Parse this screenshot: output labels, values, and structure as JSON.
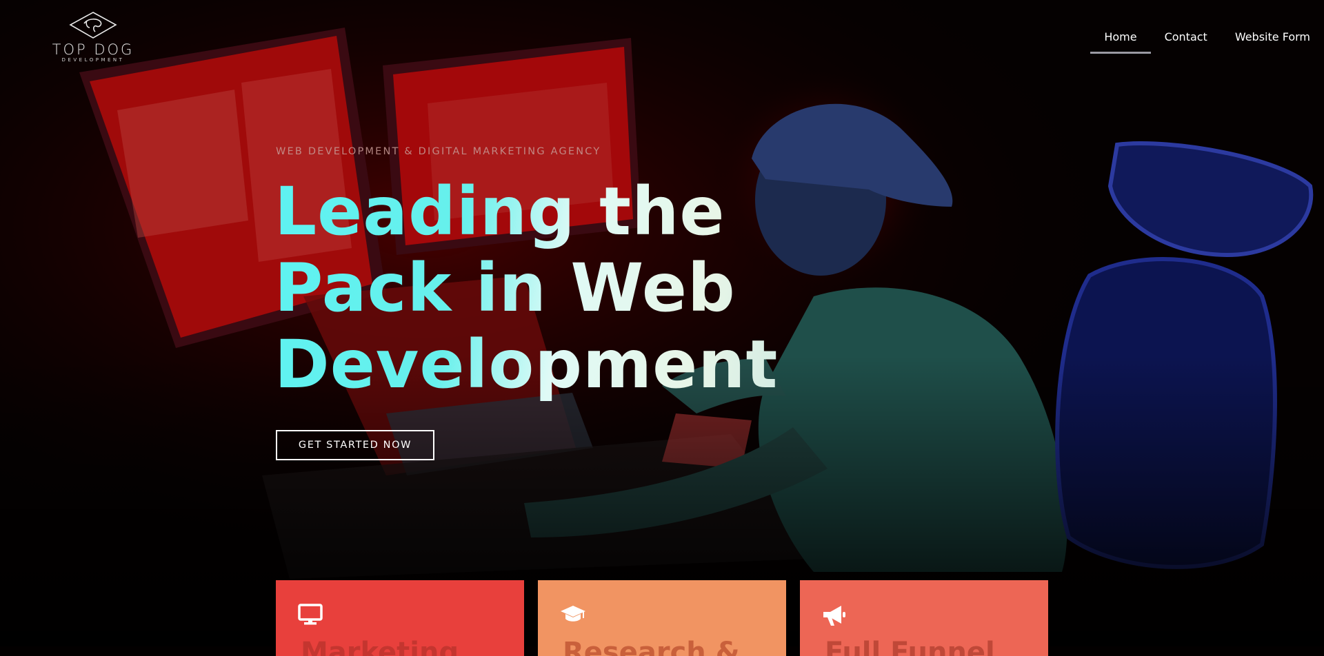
{
  "brand": {
    "name": "TOP DOG",
    "tagline": "DEVELOPMENT"
  },
  "nav": {
    "items": [
      {
        "label": "Home",
        "active": true
      },
      {
        "label": "Contact",
        "active": false
      },
      {
        "label": "Website Form",
        "active": false
      }
    ]
  },
  "hero": {
    "eyebrow": "WEB DEVELOPMENT & DIGITAL MARKETING AGENCY",
    "headline_lines": [
      "Leading the",
      "Pack in Web",
      "Development"
    ],
    "cta_label": "GET STARTED NOW"
  },
  "services": [
    {
      "icon": "monitor-icon",
      "title": "Marketing",
      "color": "#e8403c"
    },
    {
      "icon": "graduation-cap-icon",
      "title": "Research &",
      "color": "#f19462"
    },
    {
      "icon": "megaphone-icon",
      "title": "Full Funnel",
      "color": "#ed6655"
    }
  ],
  "colors": {
    "background": "#030000",
    "headline_accent": "#5ef2f1",
    "headline_light": "#dffaf6",
    "eyebrow": "#c79b96"
  }
}
